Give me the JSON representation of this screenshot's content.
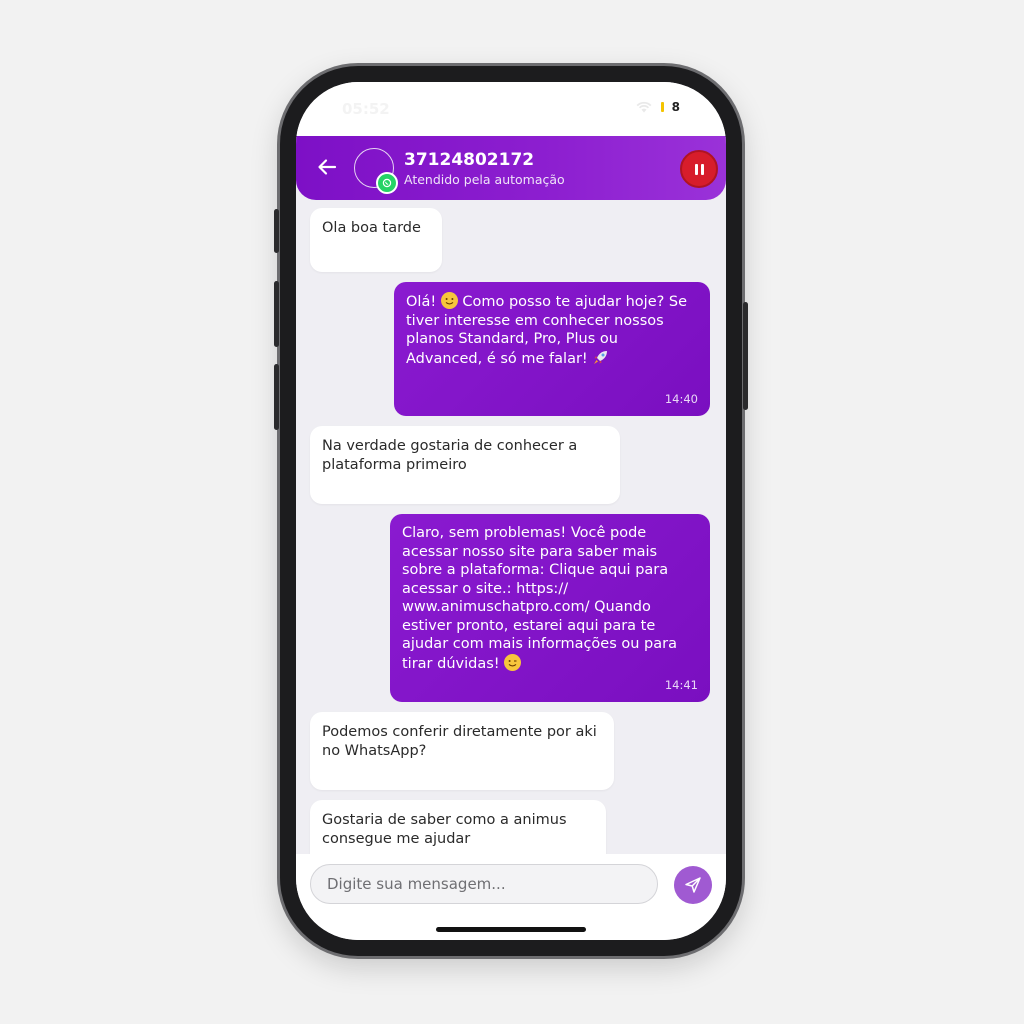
{
  "status": {
    "time": "05:52",
    "battery": "8"
  },
  "header": {
    "contact": "37124802172",
    "subtitle": "Atendido pela automação"
  },
  "messages": [
    {
      "dir": "in",
      "text": "Ola boa tarde"
    },
    {
      "dir": "out",
      "text": "Olá! [smile] Como posso te ajudar hoje? Se tiver interesse em conhecer nossos planos Standard, Pro, Plus ou Advanced, é só me falar! [rocket]",
      "time": "14:40"
    },
    {
      "dir": "in",
      "text": "Na verdade gostaria de conhecer a plataforma primeiro"
    },
    {
      "dir": "out",
      "text": "Claro, sem problemas! Você pode acessar nosso site para saber mais sobre a plataforma:  Clique aqui para acessar o site.: https:// www.animuschatpro.com/  Quando estiver pronto, estarei aqui para te ajudar com mais informações ou para tirar dúvidas! [wink]",
      "time": "14:41"
    },
    {
      "dir": "in",
      "text": "Podemos conferir diretamente por aki no WhatsApp?"
    },
    {
      "dir": "in",
      "text": "Gostaria de saber como a animus consegue me ajudar"
    }
  ],
  "composer": {
    "placeholder": "Digite sua mensagem..."
  },
  "colors": {
    "accent": "#7d10c6",
    "pause": "#d71d2b",
    "send": "#a05ad2",
    "whatsapp": "#25d366"
  }
}
